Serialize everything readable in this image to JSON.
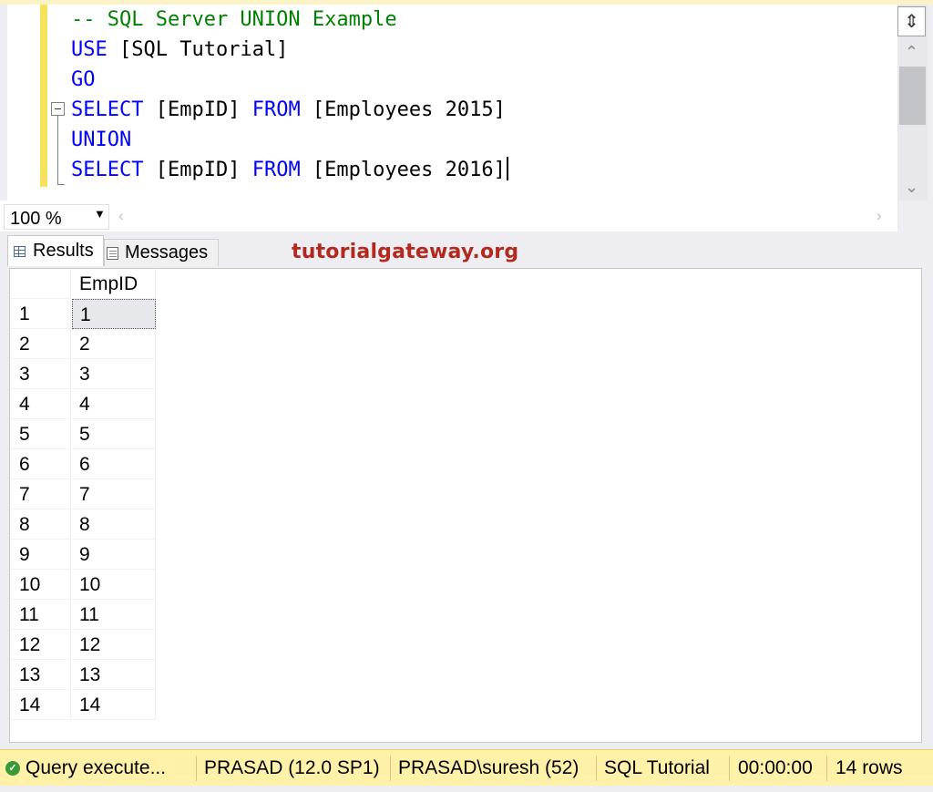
{
  "editor": {
    "lines": [
      {
        "parts": [
          {
            "t": "-- SQL Server UNION Example",
            "c": "cm"
          }
        ]
      },
      {
        "parts": [
          {
            "t": "USE",
            "c": "kw"
          },
          {
            "t": " [SQL Tutorial]",
            "c": "tx"
          }
        ]
      },
      {
        "parts": [
          {
            "t": "GO",
            "c": "kw"
          }
        ]
      },
      {
        "parts": [
          {
            "t": "SELECT",
            "c": "kw"
          },
          {
            "t": " [EmpID] ",
            "c": "tx"
          },
          {
            "t": "FROM",
            "c": "kw"
          },
          {
            "t": " [Employees 2015]",
            "c": "tx"
          }
        ]
      },
      {
        "parts": [
          {
            "t": "UNION",
            "c": "kw"
          }
        ]
      },
      {
        "parts": [
          {
            "t": "SELECT",
            "c": "kw"
          },
          {
            "t": " [EmpID] ",
            "c": "tx"
          },
          {
            "t": "FROM",
            "c": "kw"
          },
          {
            "t": " [Employees 2016]",
            "c": "tx"
          }
        ]
      }
    ],
    "colors": {
      "keyword": "#0000ff",
      "comment": "#008000",
      "text": "#000000"
    }
  },
  "zoom": {
    "value": "100 %"
  },
  "tabs": {
    "results": "Results",
    "messages": "Messages"
  },
  "watermark": "tutorialgateway.org",
  "grid": {
    "column": "EmpID",
    "rows": [
      {
        "num": "1",
        "value": "1"
      },
      {
        "num": "2",
        "value": "2"
      },
      {
        "num": "3",
        "value": "3"
      },
      {
        "num": "4",
        "value": "4"
      },
      {
        "num": "5",
        "value": "5"
      },
      {
        "num": "6",
        "value": "6"
      },
      {
        "num": "7",
        "value": "7"
      },
      {
        "num": "8",
        "value": "8"
      },
      {
        "num": "9",
        "value": "9"
      },
      {
        "num": "10",
        "value": "10"
      },
      {
        "num": "11",
        "value": "11"
      },
      {
        "num": "12",
        "value": "12"
      },
      {
        "num": "13",
        "value": "13"
      },
      {
        "num": "14",
        "value": "14"
      }
    ]
  },
  "status": {
    "message": "Query execute...",
    "server": "PRASAD (12.0 SP1)",
    "user": "PRASAD\\suresh (52)",
    "database": "SQL Tutorial",
    "time": "00:00:00",
    "rows": "14 rows",
    "bar_color": "#fff1a8"
  }
}
